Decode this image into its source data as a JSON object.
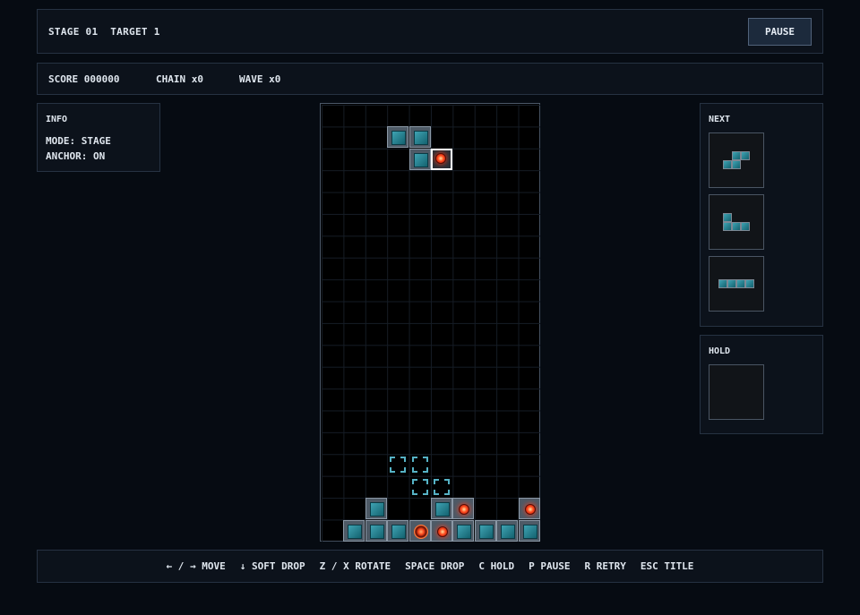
{
  "header": {
    "stage_label": "STAGE 01",
    "target_label": "TARGET 1",
    "pause_label": "PAUSE"
  },
  "stats": {
    "score": "SCORE 000000",
    "chain": "CHAIN x0",
    "wave": "WAVE x0"
  },
  "info": {
    "title": "INFO",
    "mode": "MODE: STAGE",
    "anchor": "ANCHOR: ON"
  },
  "next": {
    "title": "NEXT"
  },
  "hold": {
    "title": "HOLD"
  },
  "controls": [
    "← / → MOVE",
    "↓ SOFT DROP",
    "Z / X ROTATE",
    "SPACE DROP",
    "C HOLD",
    "P PAUSE",
    "R RETRY",
    "ESC TITLE"
  ],
  "board": {
    "columns": 10,
    "rows": 20,
    "active_piece": [
      {
        "col": 3,
        "row": 1,
        "kind": "block"
      },
      {
        "col": 4,
        "row": 1,
        "kind": "block"
      },
      {
        "col": 4,
        "row": 2,
        "kind": "block"
      },
      {
        "col": 5,
        "row": 2,
        "kind": "anchor"
      }
    ],
    "ghost_piece": [
      {
        "col": 3,
        "row": 16
      },
      {
        "col": 4,
        "row": 16
      },
      {
        "col": 4,
        "row": 17
      },
      {
        "col": 5,
        "row": 17
      }
    ],
    "placed": [
      {
        "col": 2,
        "row": 18,
        "kind": "block"
      },
      {
        "col": 5,
        "row": 18,
        "kind": "block"
      },
      {
        "col": 6,
        "row": 18,
        "kind": "core"
      },
      {
        "col": 9,
        "row": 18,
        "kind": "core"
      },
      {
        "col": 1,
        "row": 19,
        "kind": "block"
      },
      {
        "col": 2,
        "row": 19,
        "kind": "block"
      },
      {
        "col": 3,
        "row": 19,
        "kind": "block"
      },
      {
        "col": 4,
        "row": 19,
        "kind": "core-ring"
      },
      {
        "col": 5,
        "row": 19,
        "kind": "core"
      },
      {
        "col": 6,
        "row": 19,
        "kind": "block"
      },
      {
        "col": 7,
        "row": 19,
        "kind": "block"
      },
      {
        "col": 8,
        "row": 19,
        "kind": "block"
      },
      {
        "col": 9,
        "row": 19,
        "kind": "block"
      }
    ]
  },
  "next_queue": [
    {
      "name": "s-piece",
      "cells": [
        [
          1,
          0
        ],
        [
          2,
          0
        ],
        [
          0,
          1
        ],
        [
          1,
          1
        ]
      ]
    },
    {
      "name": "j-piece",
      "cells": [
        [
          0,
          0
        ],
        [
          0,
          1
        ],
        [
          1,
          1
        ],
        [
          2,
          1
        ]
      ]
    },
    {
      "name": "i-piece",
      "cells": [
        [
          0,
          0
        ],
        [
          1,
          0
        ],
        [
          2,
          0
        ],
        [
          3,
          0
        ]
      ]
    }
  ],
  "colors": {
    "block": "#2a8d9c",
    "core": "#ff3b1a",
    "ghost": "#56b3c6",
    "background": "#060b12"
  }
}
